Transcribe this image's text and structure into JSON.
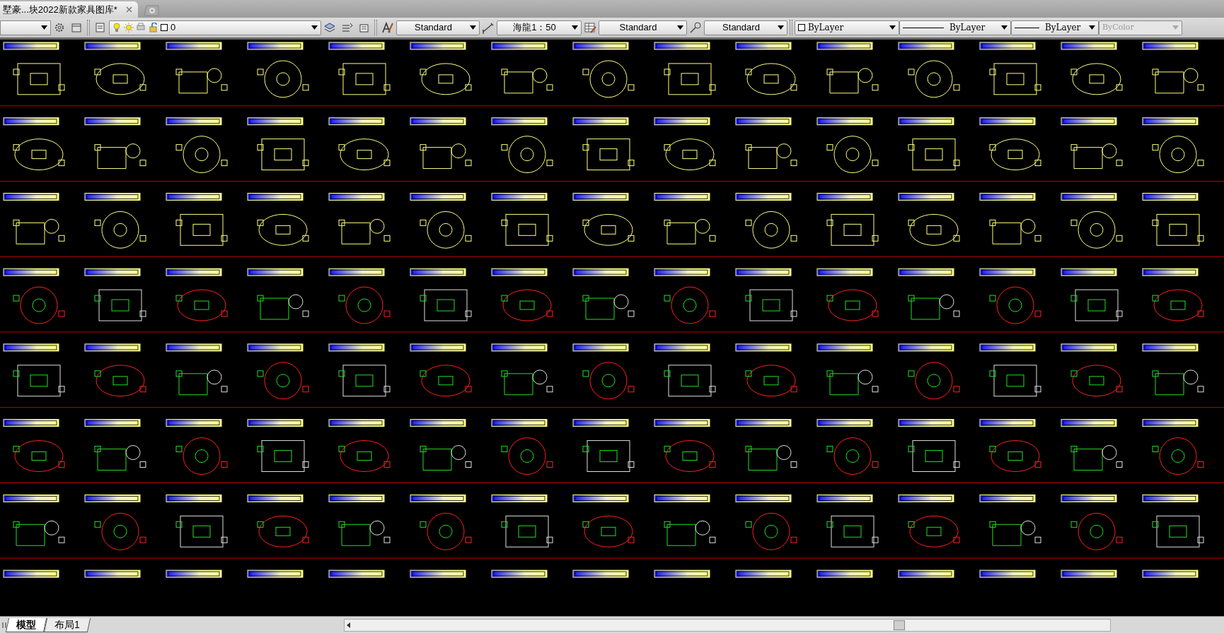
{
  "document_tabs": [
    {
      "label": "墅豪...块2022新款家具图库*",
      "selected": true
    }
  ],
  "toolbar": [
    {
      "kind": "layer",
      "value": "0",
      "disabled": false
    },
    {
      "kind": "text-style",
      "value": "Standard",
      "disabled": false
    },
    {
      "kind": "dim-style",
      "value": "海龍1：50",
      "disabled": false
    },
    {
      "kind": "table-style",
      "value": "Standard",
      "disabled": false
    },
    {
      "kind": "mleader-style",
      "value": "Standard",
      "disabled": false
    },
    {
      "kind": "color",
      "value": "ByLayer",
      "disabled": false
    },
    {
      "kind": "linetype",
      "value": "ByLayer",
      "disabled": false
    },
    {
      "kind": "lineweight",
      "value": "ByLayer",
      "disabled": false
    },
    {
      "kind": "plot-style",
      "value": "ByColor",
      "disabled": true
    }
  ],
  "layout_tabs": [
    {
      "label": "模型",
      "selected": true
    },
    {
      "label": "布局1",
      "selected": false
    }
  ]
}
